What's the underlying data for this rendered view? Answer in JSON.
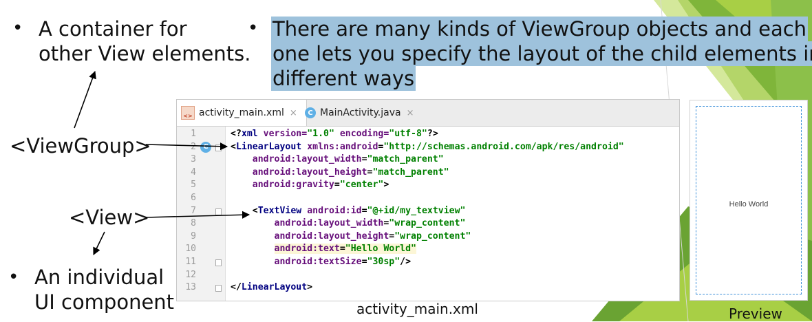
{
  "bullets": {
    "left_top": {
      "line1": "A container for",
      "line2": "other View elements."
    },
    "right_top": {
      "line1": "There are many kinds of ViewGroup objects and each",
      "line2": "one lets you specify the layout of the child elements in",
      "line3": "different ways"
    },
    "bottom_left": {
      "line1": "An individual",
      "line2": "UI component"
    },
    "marker": "•"
  },
  "labels": {
    "viewgroup": "<ViewGroup>",
    "view": "<View>"
  },
  "editor": {
    "tabs": [
      {
        "label": "activity_main.xml",
        "icon": "xml-file-icon",
        "close": "×"
      },
      {
        "label": "MainActivity.java",
        "icon": "java-class-icon",
        "icon_letter": "C",
        "close": "×"
      }
    ],
    "gutter_letter": "C",
    "lines": [
      {
        "n": "1",
        "parts": [
          "<?",
          "xml",
          " version=",
          "\"1.0\"",
          " encoding=",
          "\"utf-8\"",
          "?>"
        ]
      },
      {
        "n": "2",
        "parts": [
          "<",
          "LinearLayout",
          " ",
          "xmlns:android",
          "=",
          "\"http://schemas.android.com/apk/res/android\""
        ]
      },
      {
        "n": "3",
        "parts": [
          "    ",
          "android:layout_width",
          "=",
          "\"match_parent\""
        ]
      },
      {
        "n": "4",
        "parts": [
          "    ",
          "android:layout_height",
          "=",
          "\"match_parent\""
        ]
      },
      {
        "n": "5",
        "parts": [
          "    ",
          "android:gravity",
          "=",
          "\"center\"",
          ">"
        ]
      },
      {
        "n": "6",
        "parts": []
      },
      {
        "n": "7",
        "parts": [
          "    <",
          "TextView",
          " ",
          "android:id",
          "=",
          "\"@+id/my_textview\""
        ]
      },
      {
        "n": "8",
        "parts": [
          "        ",
          "android:layout_width",
          "=",
          "\"wrap_content\""
        ]
      },
      {
        "n": "9",
        "parts": [
          "        ",
          "android:layout_height",
          "=",
          "\"wrap_content\""
        ]
      },
      {
        "n": "10",
        "parts": [
          "        ",
          "android:text",
          "=",
          "\"Hello World\""
        ]
      },
      {
        "n": "11",
        "parts": [
          "        ",
          "android:textSize",
          "=",
          "\"30sp\"",
          "/>"
        ]
      },
      {
        "n": "12",
        "parts": []
      },
      {
        "n": "13",
        "parts": [
          "</",
          "LinearLayout",
          ">"
        ]
      }
    ]
  },
  "preview": {
    "text": "Hello World"
  },
  "captions": {
    "editor": "activity_main.xml",
    "preview": "Preview"
  },
  "colors": {
    "highlight": "#9ec2dc",
    "green_light": "#a8cf45",
    "green_dark": "#5f9b2a"
  }
}
